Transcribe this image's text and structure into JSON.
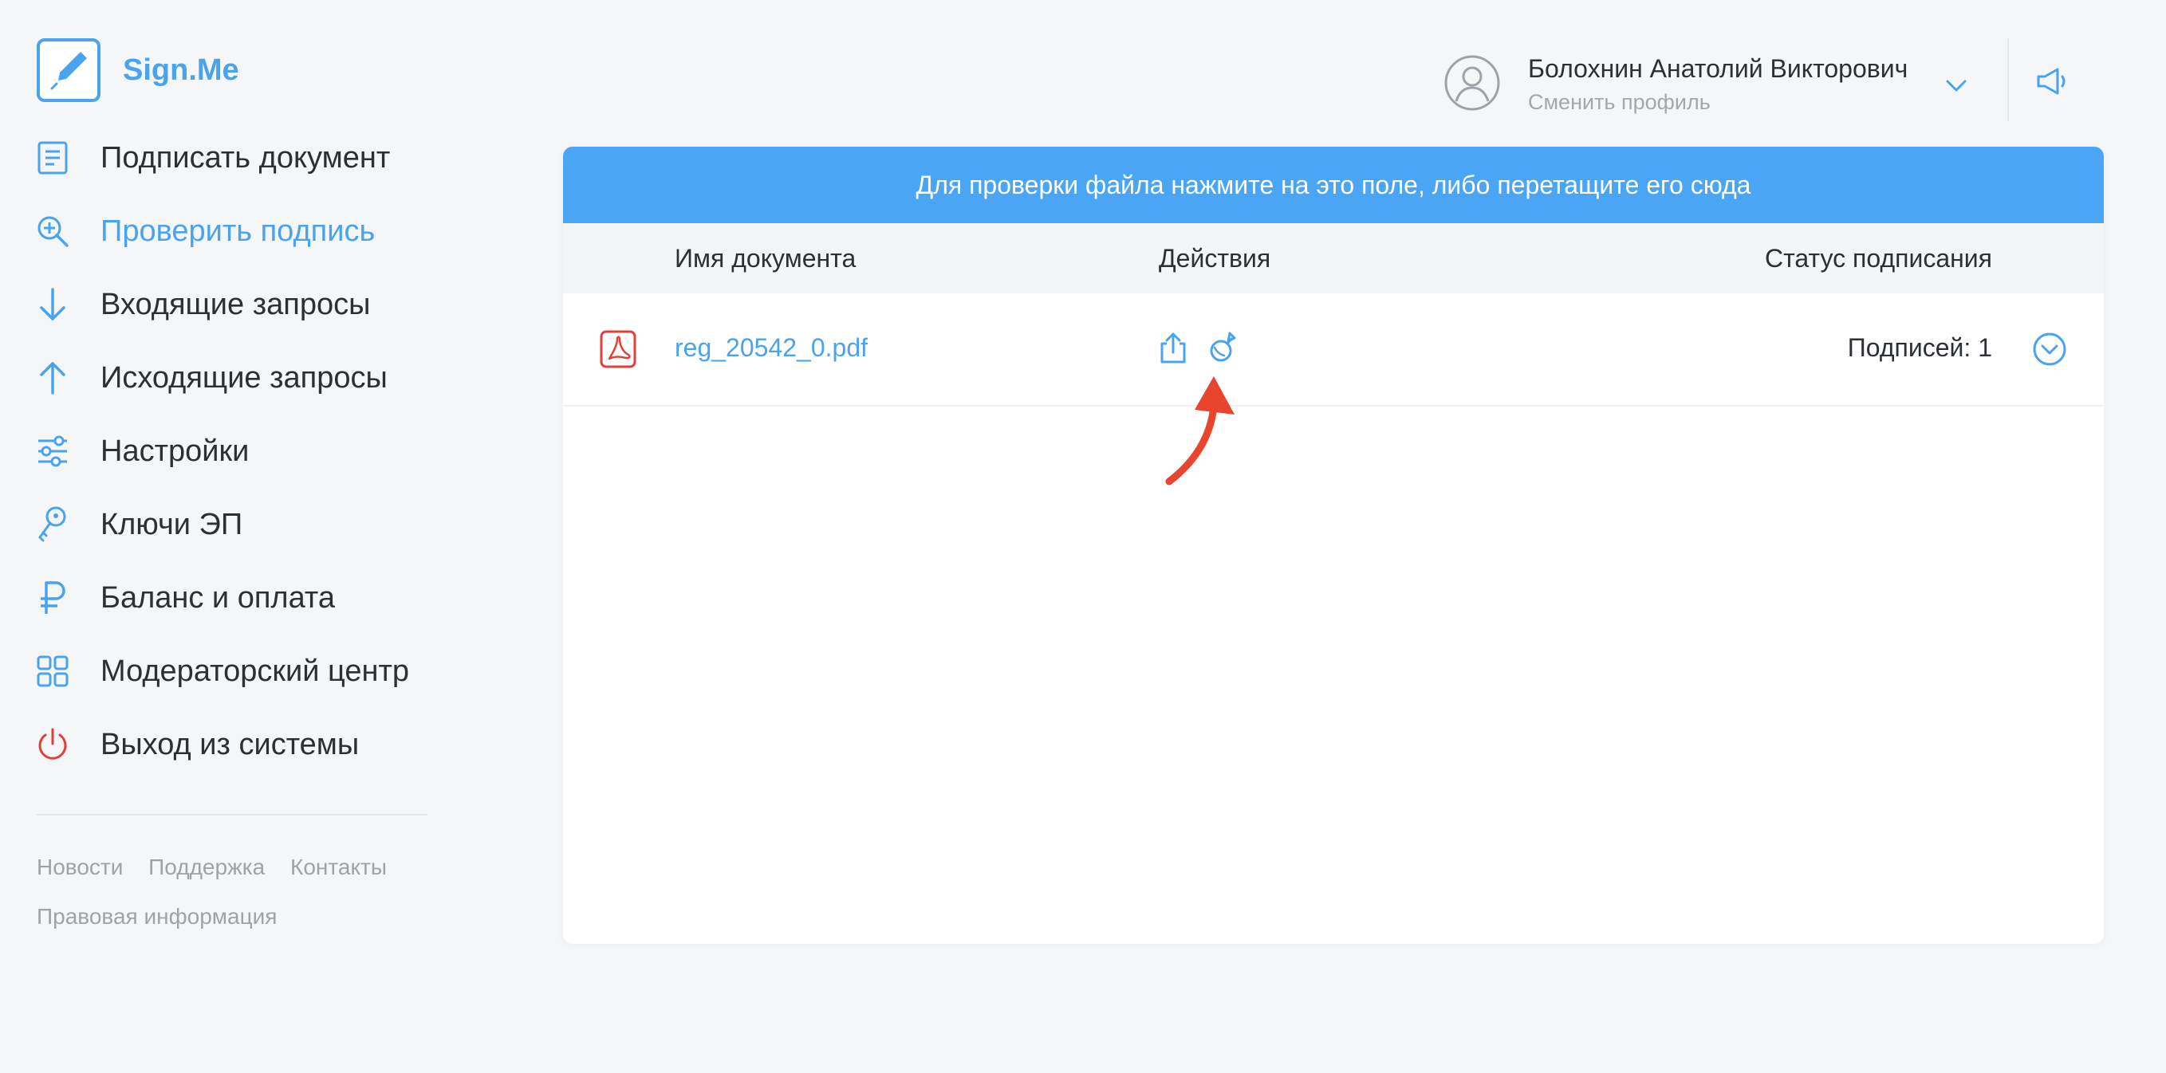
{
  "brand": {
    "name": "Sign.Me"
  },
  "sidebar": {
    "items": [
      {
        "label": "Подписать документ",
        "icon": "document-icon"
      },
      {
        "label": "Проверить подпись",
        "icon": "search-check-icon"
      },
      {
        "label": "Входящие запросы",
        "icon": "arrow-down-icon"
      },
      {
        "label": "Исходящие запросы",
        "icon": "arrow-up-icon"
      },
      {
        "label": "Настройки",
        "icon": "sliders-icon"
      },
      {
        "label": "Ключи ЭП",
        "icon": "key-icon"
      },
      {
        "label": "Баланс и оплата",
        "icon": "ruble-icon"
      },
      {
        "label": "Модераторский центр",
        "icon": "grid-icon"
      },
      {
        "label": "Выход из системы",
        "icon": "power-icon"
      }
    ],
    "active_index": 1
  },
  "footer": {
    "links": [
      "Новости",
      "Поддержка",
      "Контакты"
    ],
    "legal": "Правовая информация"
  },
  "header": {
    "user_name": "Болохнин Анатолий Викторович",
    "switch_profile": "Сменить профиль"
  },
  "main": {
    "dropzone_text": "Для проверки файла нажмите на это поле, либо перетащите его сюда",
    "columns": {
      "name": "Имя документа",
      "actions": "Действия",
      "status": "Статус подписания"
    },
    "rows": [
      {
        "file_name": "reg_20542_0.pdf",
        "status": "Подписей: 1"
      }
    ]
  },
  "colors": {
    "accent": "#4aa3ef",
    "dropzone": "#4aa6f5",
    "pdf": "#e0403a",
    "power": "#e0403a",
    "annotation_arrow": "#e8442e"
  }
}
